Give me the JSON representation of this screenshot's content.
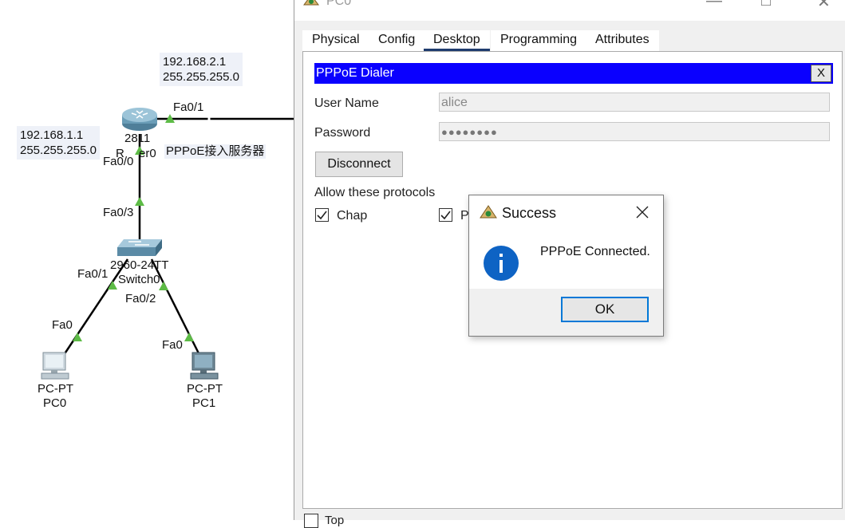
{
  "topology": {
    "router": {
      "model": "2811",
      "name_partial": "R",
      "name_tail": "er0",
      "annotation": "PPPoE接入服务器",
      "ip_upper": "192.168.2.1",
      "mask_upper": "255.255.255.0",
      "ip_left": "192.168.1.1",
      "mask_left": "255.255.255.0",
      "port_uplink": "Fa0/1",
      "port_down": "Fa0/0"
    },
    "switch": {
      "model": "2960-24TT",
      "name": "Switch0",
      "port_up": "Fa0/3",
      "port_left": "Fa0/1",
      "port_right": "Fa0/2"
    },
    "pcs": [
      {
        "model": "PC-PT",
        "name": "PC0",
        "port": "Fa0"
      },
      {
        "model": "PC-PT",
        "name": "PC1",
        "port": "Fa0"
      }
    ]
  },
  "window": {
    "title": "PC0",
    "controls": {
      "minimize": "—",
      "maximize": "□",
      "close": "✕"
    },
    "tabs": [
      {
        "label": "Physical",
        "active": false
      },
      {
        "label": "Config",
        "active": false
      },
      {
        "label": "Desktop",
        "active": true
      },
      {
        "label": "Programming",
        "active": false
      },
      {
        "label": "Attributes",
        "active": false
      }
    ],
    "dialer": {
      "title": "PPPoE Dialer",
      "close_label": "X",
      "username_label": "User Name",
      "username_value": "alice",
      "password_label": "Password",
      "password_value": "●●●●●●●●",
      "disconnect_label": "Disconnect",
      "protocols_label": "Allow these protocols",
      "protocols": [
        {
          "label": "Chap",
          "checked": true
        },
        {
          "label": "P",
          "checked": true
        }
      ]
    },
    "bottom_checkbox_label": "Top"
  },
  "modal": {
    "title": "Success",
    "message": "PPPoE Connected.",
    "ok_label": "OK",
    "close_label": "✕"
  },
  "colors": {
    "dialer_bar": "#0a00ff",
    "link_up": "#5dbb46",
    "info_icon": "#0e63c4",
    "ok_border": "#0078d7"
  }
}
